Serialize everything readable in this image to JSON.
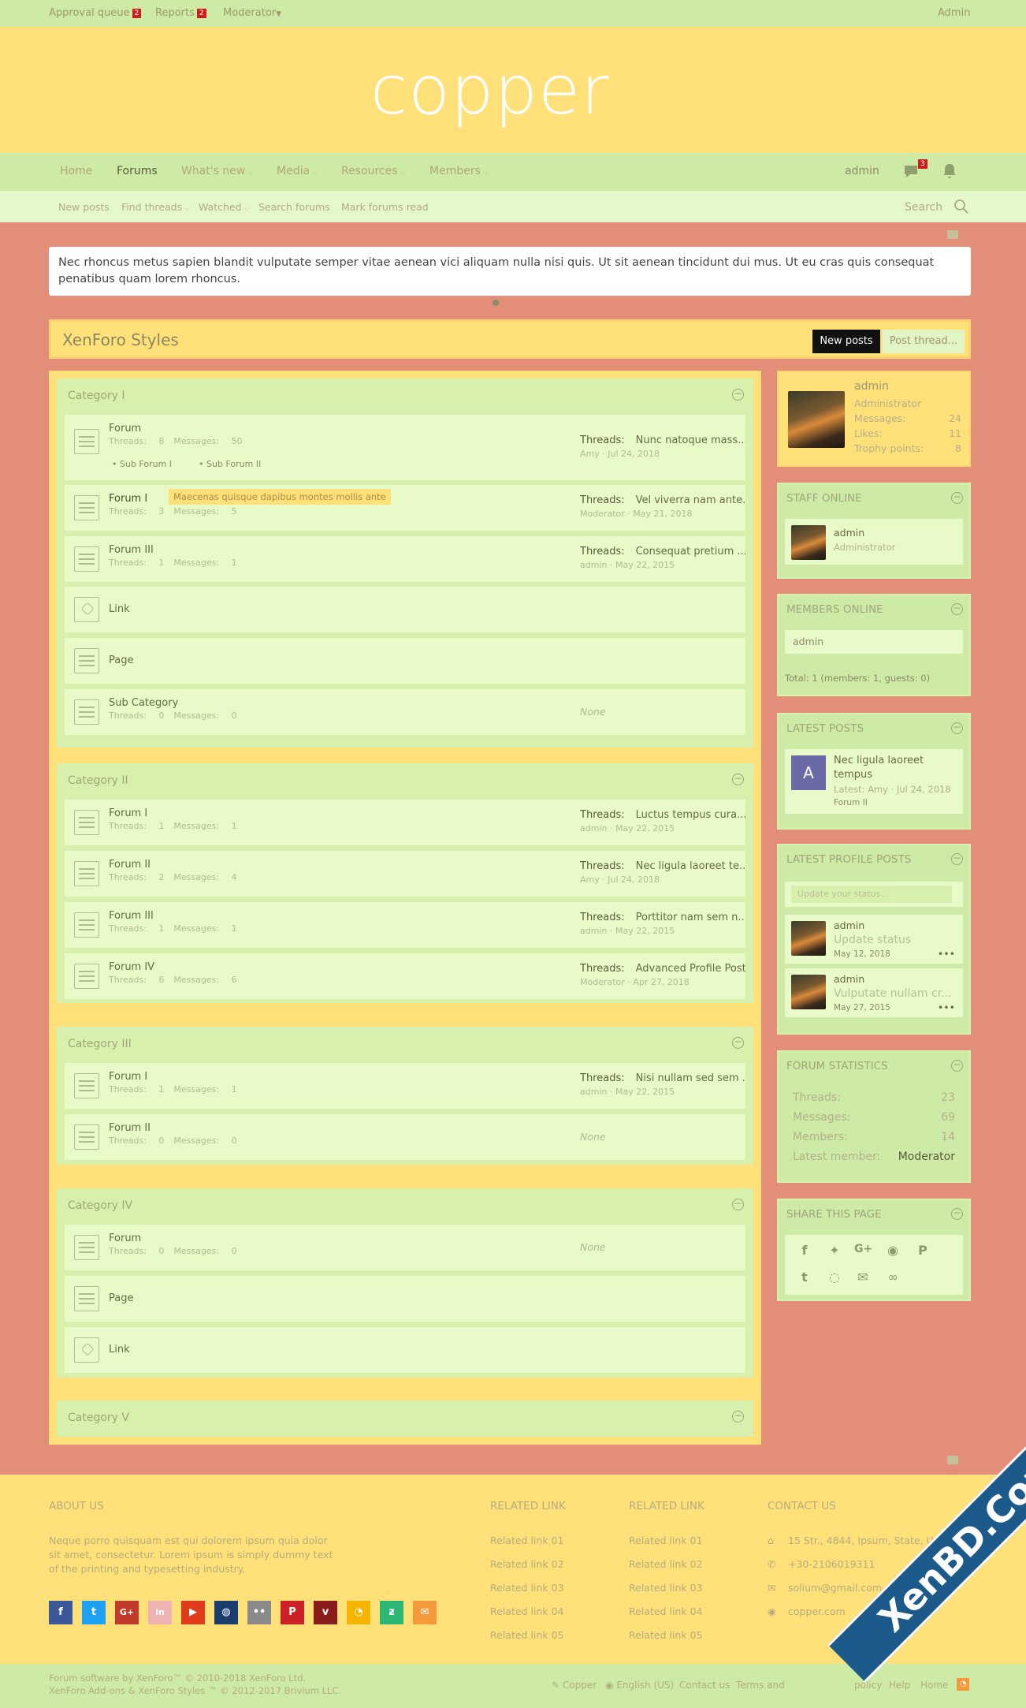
{
  "staff_bar": {
    "approval_queue": "Approval queue",
    "approval_count": "2",
    "reports": "Reports",
    "reports_count": "2",
    "moderator": "Moderator",
    "admin": "Admin"
  },
  "logo_text": "copper",
  "nav": {
    "tabs": [
      "Home",
      "Forums",
      "What's new",
      "Media",
      "Resources",
      "Members"
    ],
    "user": "admin",
    "alert_count": "3"
  },
  "subnav": {
    "items": [
      "New posts",
      "Find threads",
      "Watched",
      "Search forums",
      "Mark forums read"
    ],
    "search": "Search"
  },
  "notice": "Nec rhoncus metus sapien blandit vulputate semper vitae aenean vici aliquam nulla nisi quis. Ut sit aenean tincidunt dui mus. Ut eu cras quis consequat penatibus quam lorem rhoncus.",
  "page_title": "XenForo Styles",
  "buttons": {
    "new_posts": "New posts",
    "post_thread": "Post thread..."
  },
  "labels": {
    "threads": "Threads:",
    "messages": "Messages:",
    "last_threads": "Threads:",
    "none": "None",
    "collapse": "−"
  },
  "categories": [
    {
      "title": "Category I",
      "nodes": [
        {
          "title": "Forum",
          "threads": "8",
          "messages": "50",
          "subforums": [
            "Sub Forum I",
            "Sub Forum II"
          ],
          "last_title": "Nunc natoque mass...",
          "last_meta": "Amy · Jul 24, 2018"
        },
        {
          "title": "Forum I",
          "threads": "3",
          "messages": "5",
          "tooltip": "Maecenas quisque dapibus montes mollis ante",
          "last_title": "Vel viverra nam ante...",
          "last_meta": "Moderator · May 21, 2018"
        },
        {
          "title": "Forum III",
          "threads": "1",
          "messages": "1",
          "last_title": "Consequat pretium ...",
          "last_meta": "admin · May 22, 2015"
        },
        {
          "title": "Link"
        },
        {
          "title": "Page"
        },
        {
          "title": "Sub Category",
          "threads": "0",
          "messages": "0",
          "none": true
        }
      ]
    },
    {
      "title": "Category II",
      "nodes": [
        {
          "title": "Forum I",
          "threads": "1",
          "messages": "1",
          "last_title": "Luctus tempus cura...",
          "last_meta": "admin · May 22, 2015"
        },
        {
          "title": "Forum II",
          "threads": "2",
          "messages": "4",
          "last_title": "Nec ligula laoreet te...",
          "last_meta": "Amy · Jul 24, 2018"
        },
        {
          "title": "Forum III",
          "threads": "1",
          "messages": "1",
          "last_title": "Porttitor nam sem n...",
          "last_meta": "admin · May 22, 2015"
        },
        {
          "title": "Forum IV",
          "threads": "6",
          "messages": "6",
          "last_title": "Advanced Profile Post",
          "last_meta": "Moderator · Apr 27, 2018"
        }
      ]
    },
    {
      "title": "Category III",
      "nodes": [
        {
          "title": "Forum I",
          "threads": "1",
          "messages": "1",
          "last_title": "Nisi nullam sed sem ...",
          "last_meta": "admin · May 22, 2015"
        },
        {
          "title": "Forum II",
          "threads": "0",
          "messages": "0",
          "none": true
        }
      ]
    },
    {
      "title": "Category IV",
      "nodes": [
        {
          "title": "Forum",
          "threads": "0",
          "messages": "0",
          "none": true
        },
        {
          "title": "Page"
        },
        {
          "title": "Link"
        }
      ]
    },
    {
      "title": "Category V",
      "nodes": []
    }
  ],
  "sidebar": {
    "profile": {
      "name": "admin",
      "role": "Administrator",
      "messages_label": "Messages:",
      "messages": "24",
      "likes_label": "Likes:",
      "likes": "11",
      "trophy_label": "Trophy points:",
      "trophy": "8"
    },
    "staff_online": {
      "title": "STAFF ONLINE",
      "name": "admin",
      "role": "Administrator"
    },
    "members_online": {
      "title": "MEMBERS ONLINE",
      "name": "admin",
      "total": "Total: 1 (members: 1, guests: 0)"
    },
    "latest_posts": {
      "title": "LATEST POSTS",
      "avatar_letter": "A",
      "post_title": "Nec ligula laoreet tempus",
      "meta": "Latest: Amy · Jul 24, 2018",
      "forum": "Forum II"
    },
    "latest_profile_posts": {
      "title": "LATEST PROFILE POSTS",
      "placeholder": "Update your status...",
      "posts": [
        {
          "name": "admin",
          "text": "Update status",
          "date": "May 12, 2018"
        },
        {
          "name": "admin",
          "text": "Vulputate nullam cr...",
          "date": "May 27, 2015"
        }
      ]
    },
    "forum_statistics": {
      "title": "FORUM STATISTICS",
      "threads_label": "Threads:",
      "threads": "23",
      "messages_label": "Messages:",
      "messages": "69",
      "members_label": "Members:",
      "members": "14",
      "latest_label": "Latest member:",
      "latest": "Moderator"
    },
    "share": {
      "title": "SHARE THIS PAGE"
    }
  },
  "footer": {
    "about_title": "ABOUT US",
    "about_text_1": "Neque porro quisquam est qui dolorem ipsum quia dolor",
    "about_text_2": "sit amet, consectetur. Lorem ipsum is simply dummy text",
    "about_text_3": "of the printing and typesetting industry.",
    "related_title": "RELATED LINK",
    "related_links": [
      "Related link 01",
      "Related link 02",
      "Related link 03",
      "Related link 04",
      "Related link 05"
    ],
    "contact_title": "CONTACT US",
    "contact": [
      "15 Str., 4844, Ipsum, State, U",
      "+30-2106019311",
      "solium@gmail.com",
      "copper.com"
    ]
  },
  "footbar": {
    "line1": "Forum software by XenForo™ © 2010-2018 XenForo Ltd.",
    "line2": "XenForo Add-ons & XenForo Styles ™ © 2012-2017 Brivium LLC.",
    "links": [
      "Copper",
      "English (US)",
      "Contact us",
      "Terms and",
      "policy",
      "Help",
      "Home"
    ]
  },
  "watermark": "XenBD.Com",
  "colors": {
    "accent_yellow": "#ffe079",
    "accent_green": "#cdeaa6",
    "background": "#e38e78",
    "badge_red": "#d21c1c"
  }
}
